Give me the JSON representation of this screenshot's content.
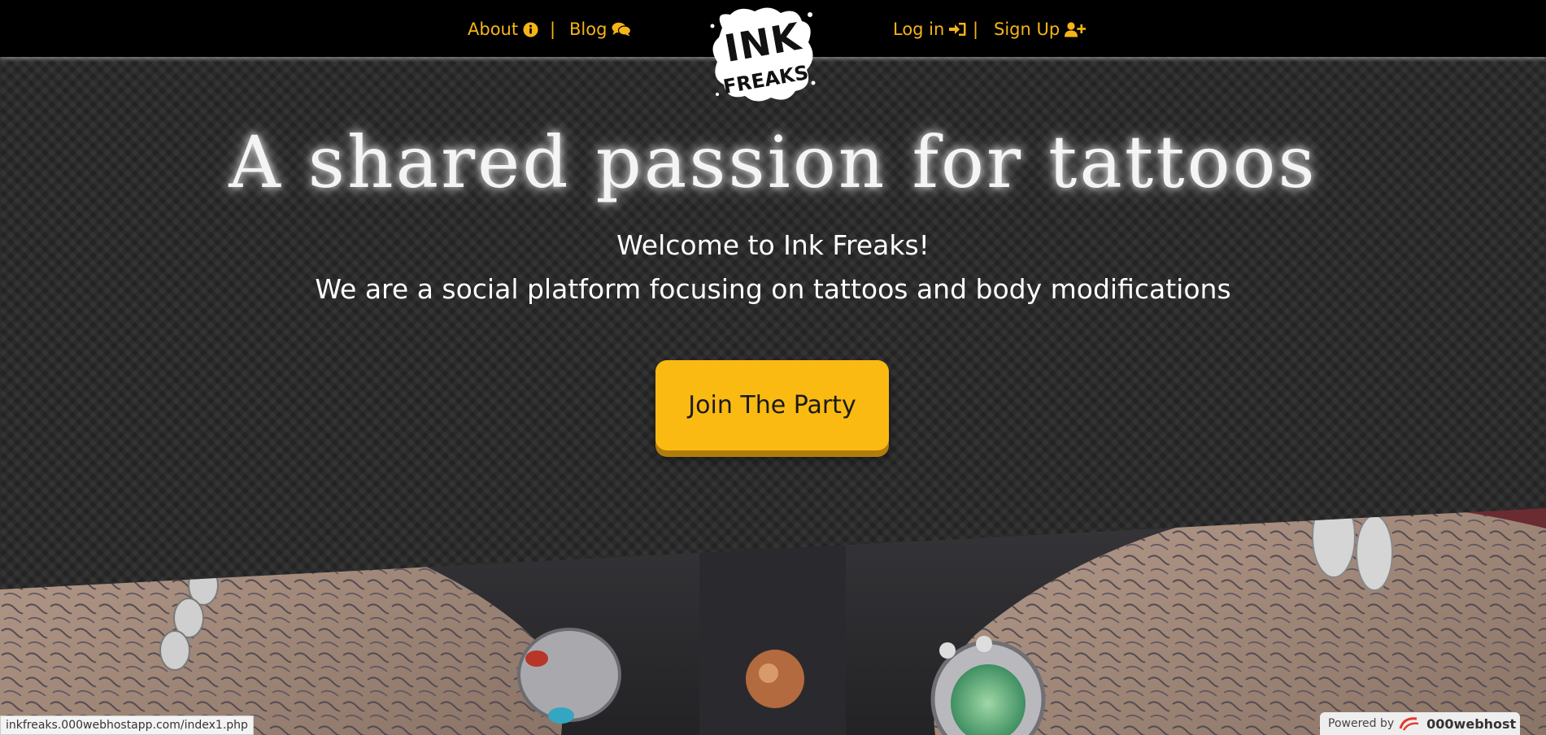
{
  "nav": {
    "about_label": "About",
    "separator": "|",
    "blog_label": "Blog",
    "login_label": "Log in",
    "signup_label": "Sign Up"
  },
  "logo": {
    "line1": "INK",
    "line2": "FREAKS"
  },
  "hero": {
    "headline": "A shared passion for tattoos",
    "welcome": "Welcome to Ink Freaks!",
    "tagline": "We are a social platform focusing on tattoos and body modifications",
    "cta_label": "Join The Party"
  },
  "status_bar": {
    "url": "inkfreaks.000webhostapp.com/index1.php"
  },
  "badge": {
    "prefix": "Powered by",
    "brand": "000webhost"
  },
  "colors": {
    "accent": "#f5b417",
    "button": "#fbba12",
    "nav_bg": "#000000",
    "hero_bg": "#2b2b2b"
  },
  "icons": [
    "info-icon",
    "comments-icon",
    "sign-in-icon",
    "user-plus-icon",
    "webhost-logo-icon"
  ]
}
